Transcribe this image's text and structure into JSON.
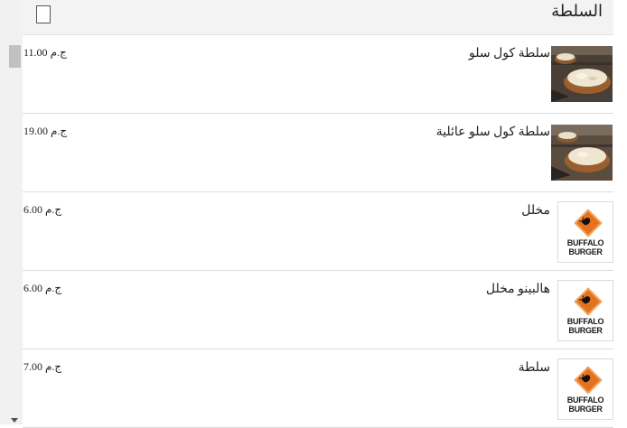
{
  "header": {
    "title": "السلطة"
  },
  "items": [
    {
      "name": "سلطة كول سلو",
      "price": "ج.م 11.00",
      "image": "coleslaw-photo"
    },
    {
      "name": "سلطة كول سلو عائلية",
      "price": "ج.م 19.00",
      "image": "coleslaw-photo"
    },
    {
      "name": "مخلل",
      "price": "ج.م 6.00",
      "image": "buffalo-burger-logo"
    },
    {
      "name": "هالبينو مخلل",
      "price": "ج.م 6.00",
      "image": "buffalo-burger-logo"
    },
    {
      "name": "سلطة",
      "price": "ج.م 7.00",
      "image": "buffalo-burger-logo"
    }
  ],
  "brand": {
    "logo_text": "BUFFALO BURGER",
    "accent_color": "#e4721c"
  }
}
